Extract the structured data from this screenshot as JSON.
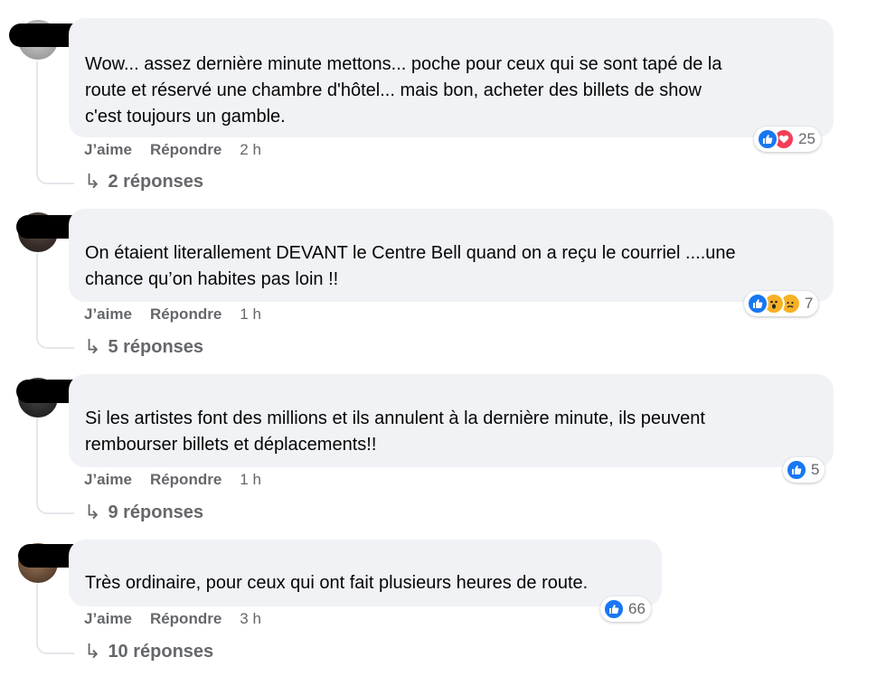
{
  "comments": [
    {
      "text": "Wow... assez dernière minute mettons... poche pour ceux qui se sont tapé de la\nroute et réservé une chambre d'hôtel... mais bon, acheter des billets de show\nc'est toujours un gamble.",
      "like_label": "J’aime",
      "reply_label": "Répondre",
      "time": "2 h",
      "reactions": [
        "like-icon",
        "love-icon"
      ],
      "reaction_count": "25",
      "replies_label": "2 réponses"
    },
    {
      "text": "On étaient literallement DEVANT le Centre Bell quand on a reçu le courriel ....une\nchance qu’on habites pas loin !!",
      "like_label": "J’aime",
      "reply_label": "Répondre",
      "time": "1 h",
      "reactions": [
        "like-icon",
        "wow-icon",
        "sad-icon"
      ],
      "reaction_count": "7",
      "replies_label": "5 réponses"
    },
    {
      "text": "Si les artistes font des millions et ils annulent à la dernière minute, ils peuvent\nrembourser billets et déplacements!!",
      "like_label": "J’aime",
      "reply_label": "Répondre",
      "time": "1 h",
      "reactions": [
        "like-icon"
      ],
      "reaction_count": "5",
      "replies_label": "9 réponses"
    },
    {
      "text": "Très ordinaire, pour ceux qui ont fait plusieurs heures de route.",
      "like_label": "J’aime",
      "reply_label": "Répondre",
      "time": "3 h",
      "reactions": [
        "like-icon"
      ],
      "reaction_count": "66",
      "replies_label": "10 réponses"
    }
  ],
  "colors": {
    "bubble_bg": "#f0f2f5",
    "meta_text": "#65676b",
    "like_blue": "#1877f2",
    "love_red": "#f33e58",
    "emoji_yellow": "#f7b125"
  }
}
